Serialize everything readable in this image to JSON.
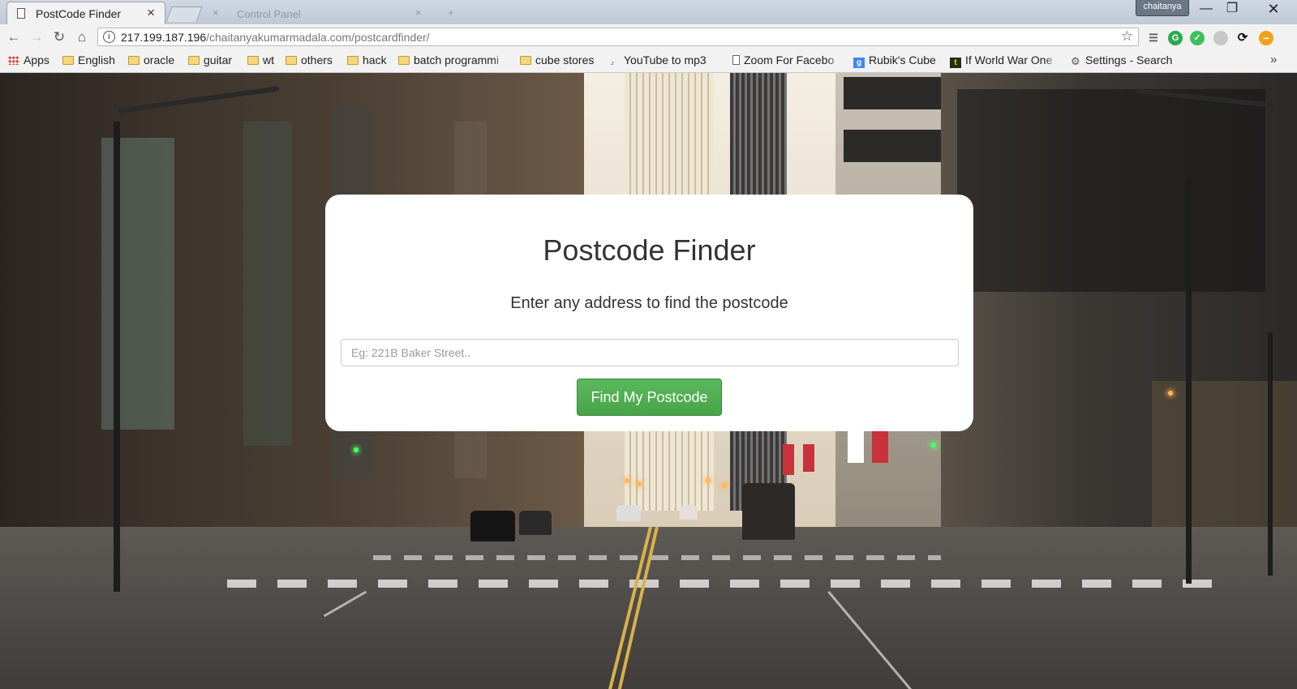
{
  "window": {
    "user_badge": "chaitanya"
  },
  "tabs": [
    {
      "title": "PostCode Finder"
    }
  ],
  "ghost_tab": {
    "title": "Control Panel"
  },
  "toolbar": {
    "url_host": "217.199.187.196",
    "url_path": "/chaitanyakumarmadala.com/postcardfinder/"
  },
  "bookmarks": [
    {
      "label": "Apps",
      "icon": "apps-grid-icon"
    },
    {
      "label": "English",
      "icon": "folder-icon"
    },
    {
      "label": "oracle",
      "icon": "folder-icon"
    },
    {
      "label": "guitar",
      "icon": "folder-icon"
    },
    {
      "label": "wt",
      "icon": "folder-icon"
    },
    {
      "label": "others",
      "icon": "folder-icon"
    },
    {
      "label": "hack",
      "icon": "folder-icon"
    },
    {
      "label": "batch programmi",
      "icon": "folder-icon"
    },
    {
      "label": "cube stores",
      "icon": "folder-icon"
    },
    {
      "label": "YouTube to mp3",
      "icon": "mp3-icon"
    },
    {
      "label": "Zoom For Facebo",
      "icon": "page-icon"
    },
    {
      "label": "Rubik's Cube",
      "icon": "google-icon"
    },
    {
      "label": "If World War One",
      "icon": "site-icon"
    },
    {
      "label": "Settings - Search",
      "icon": "gear-icon"
    }
  ],
  "finder": {
    "title": "Postcode Finder",
    "subtitle": "Enter any address to find the postcode",
    "input_placeholder": "Eg: 221B Baker Street..",
    "input_value": "",
    "button_label": "Find My Postcode"
  },
  "colors": {
    "button_green": "#5cb85c",
    "card_background": "#ffffff"
  }
}
